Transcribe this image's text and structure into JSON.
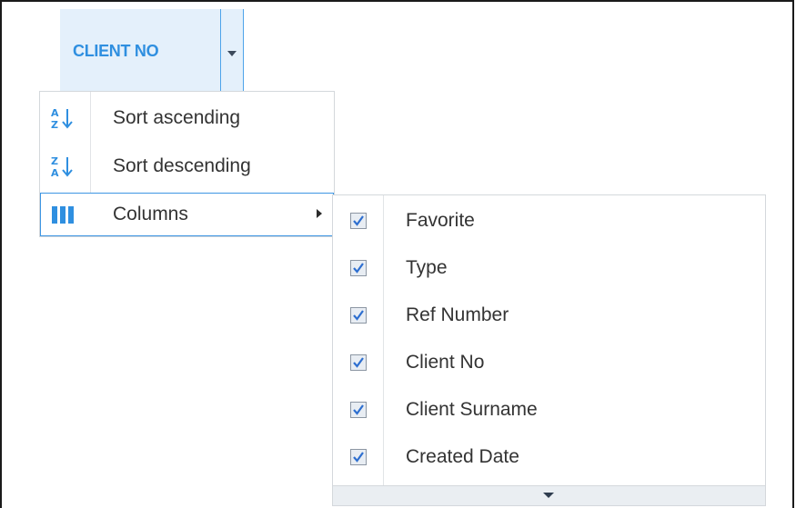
{
  "header": {
    "title": "CLIENT NO",
    "menu_icon": "chevron-down-icon"
  },
  "menu": {
    "items": [
      {
        "label": "Sort ascending",
        "icon": "sort-ascending-icon"
      },
      {
        "label": "Sort descending",
        "icon": "sort-descending-icon"
      },
      {
        "label": "Columns",
        "icon": "columns-icon"
      }
    ]
  },
  "columns_submenu": {
    "items": [
      {
        "label": "Favorite",
        "checked": true
      },
      {
        "label": "Type",
        "checked": true
      },
      {
        "label": "Ref Number",
        "checked": true
      },
      {
        "label": "Client No",
        "checked": true
      },
      {
        "label": "Client Surname",
        "checked": true
      },
      {
        "label": "Created Date",
        "checked": true
      }
    ]
  },
  "colors": {
    "accent": "#2f8fe0",
    "header_bg": "#e4f0fb",
    "checkmark": "#2e6fd0"
  }
}
